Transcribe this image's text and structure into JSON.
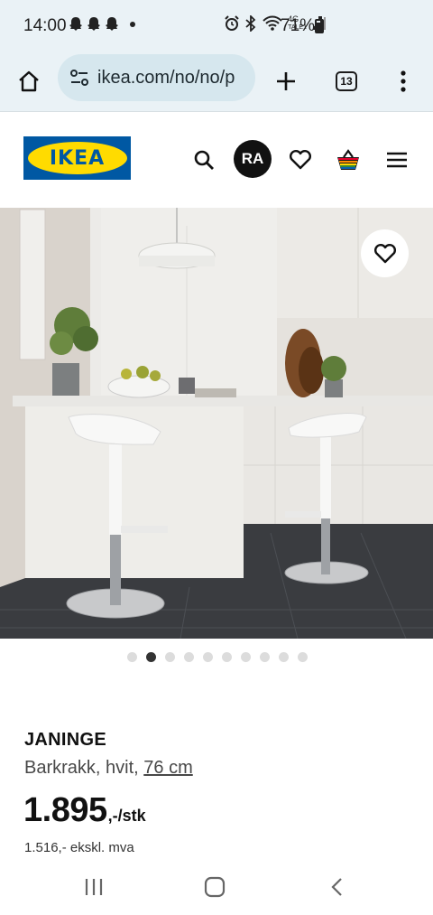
{
  "status": {
    "time": "14:00",
    "network_label": "4G",
    "network_sub": "TALE1",
    "battery": "71%"
  },
  "browser": {
    "url": "ikea.com/no/no/p",
    "tab_count": "13"
  },
  "header": {
    "logo_text": "IKEA",
    "avatar_initials": "RA"
  },
  "carousel": {
    "total": 10,
    "active_index": 1
  },
  "product": {
    "name": "JANINGE",
    "desc_prefix": "Barkrakk, hvit, ",
    "desc_size": "76 cm",
    "price_main": "1.895",
    "price_suffix": ",-/stk",
    "price_ex_vat": "1.516,- ekskl. mva"
  },
  "colors": {
    "ikea_blue": "#0058a3",
    "ikea_yellow": "#ffdb00",
    "browser_bg": "#eaf2f6",
    "url_pill": "#d6e7ee"
  }
}
